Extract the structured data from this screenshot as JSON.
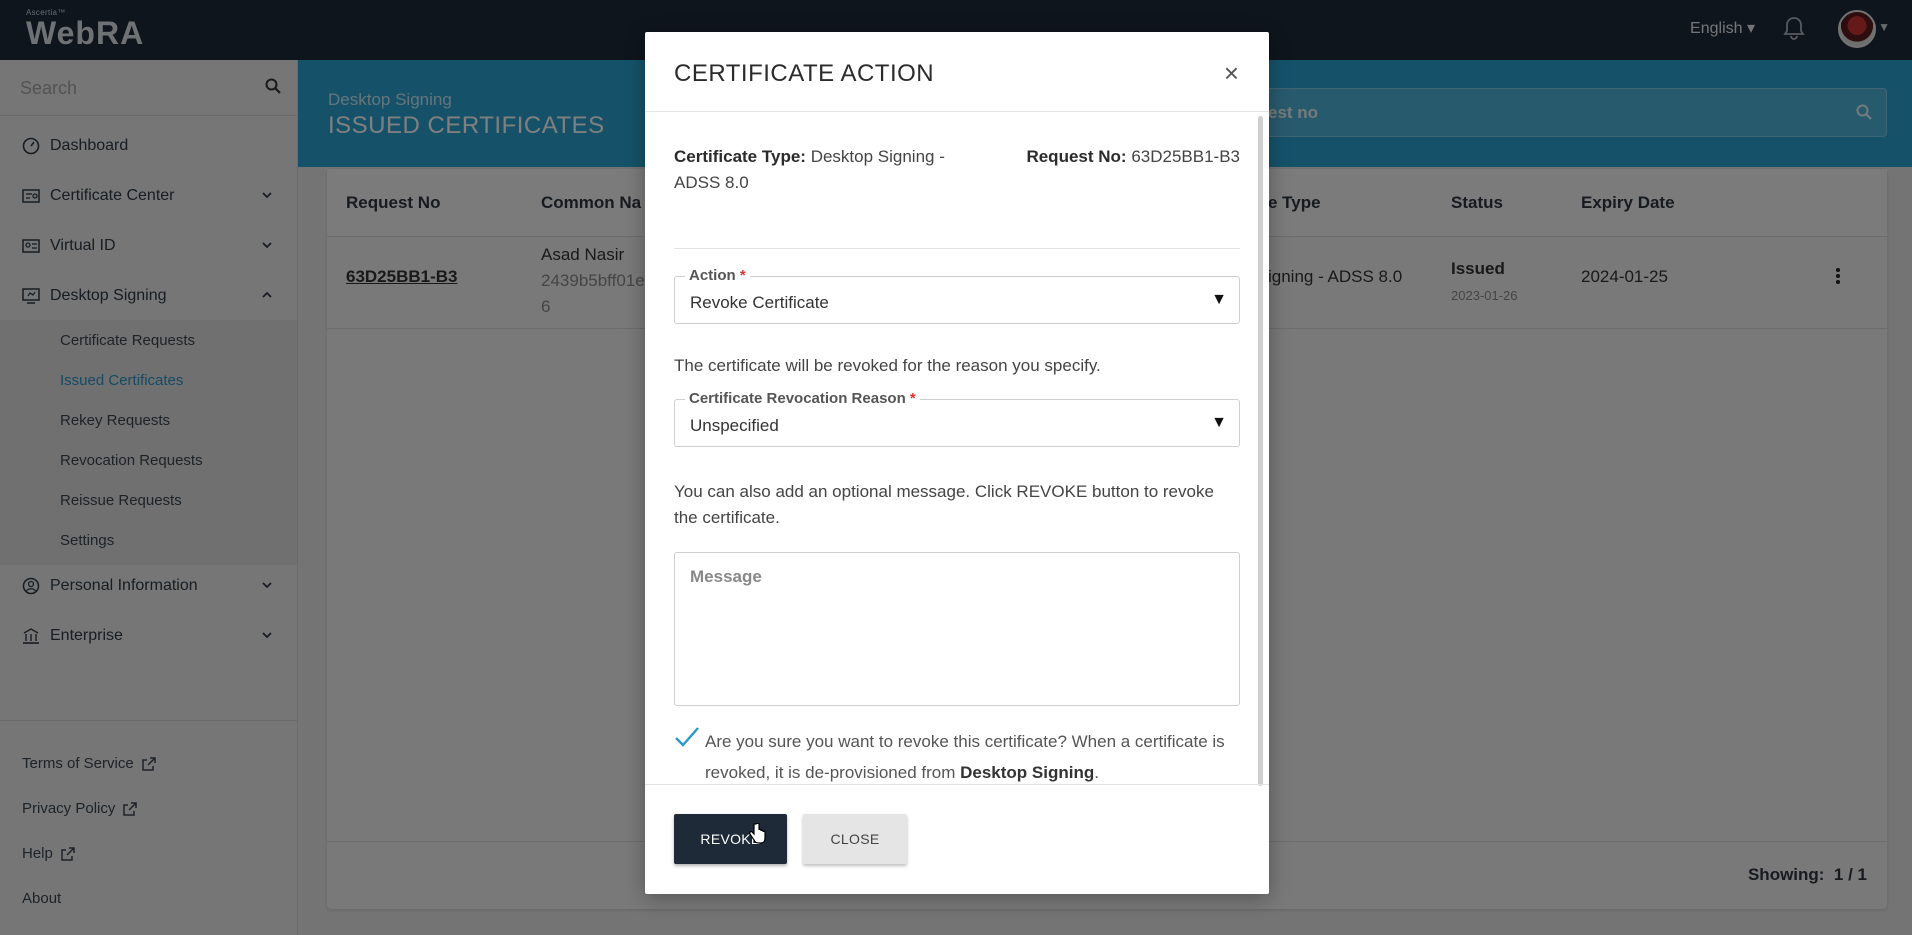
{
  "app": {
    "brand_small": "Ascertia™",
    "brand": "WebRA",
    "language": "English ▾"
  },
  "sidebar": {
    "search_placeholder": "Search",
    "items": [
      {
        "label": "Dashboard"
      },
      {
        "label": "Certificate Center"
      },
      {
        "label": "Virtual ID"
      },
      {
        "label": "Desktop Signing"
      },
      {
        "label": "Personal Information"
      },
      {
        "label": "Enterprise"
      }
    ],
    "subitems": [
      {
        "label": "Certificate Requests"
      },
      {
        "label": "Issued Certificates"
      },
      {
        "label": "Rekey Requests"
      },
      {
        "label": "Revocation Requests"
      },
      {
        "label": "Reissue Requests"
      },
      {
        "label": "Settings"
      }
    ],
    "footer_links": [
      {
        "label": "Terms of Service"
      },
      {
        "label": "Privacy Policy"
      },
      {
        "label": "Help"
      },
      {
        "label": "About"
      }
    ]
  },
  "header": {
    "breadcrumb": "Desktop Signing",
    "title": "ISSUED CERTIFICATES",
    "search_text": "est no"
  },
  "table": {
    "columns": [
      "Request No",
      "Common Na",
      "e Type",
      "Status",
      "Expiry Date"
    ],
    "row": {
      "request_no": "63D25BB1-B3",
      "common_name": "Asad Nasir",
      "common_id": "2439b5bff01e",
      "common_id_tail": "6",
      "type": "igning - ADSS 8.0",
      "status": "Issued",
      "status_date": "2023-01-26",
      "expiry": "2024-01-25"
    },
    "showing_label": "Showing:",
    "showing_value": "1 / 1"
  },
  "modal": {
    "title": "CERTIFICATE ACTION",
    "close_glyph": "×",
    "cert_type_label": "Certificate Type:",
    "cert_type_value": "Desktop Signing - ADSS 8.0",
    "request_no_label": "Request No:",
    "request_no_value": "63D25BB1-B3",
    "action_label": "Action",
    "action_value": "Revoke Certificate",
    "revoke_info": "The certificate will be revoked for the reason you specify.",
    "reason_label": "Certificate Revocation Reason",
    "reason_value": "Unspecified",
    "message_info": "You can also add an optional message. Click REVOKE button to revoke the certificate.",
    "message_placeholder": "Message",
    "confirm_text": "Are you sure you want to revoke this certificate? When a certificate is revoked, it is de-provisioned from",
    "confirm_strong": "Desktop Signing",
    "confirm_end": ".",
    "required_mark": "*",
    "caret": "▼",
    "revoke_button": "REVOKE",
    "close_button": "CLOSE",
    "confirm_checked": true
  },
  "colors": {
    "topbar": "#1f2a38",
    "accent": "#2ba4d3",
    "active_link": "#2a97c9",
    "primary_button": "#1f2a38"
  }
}
